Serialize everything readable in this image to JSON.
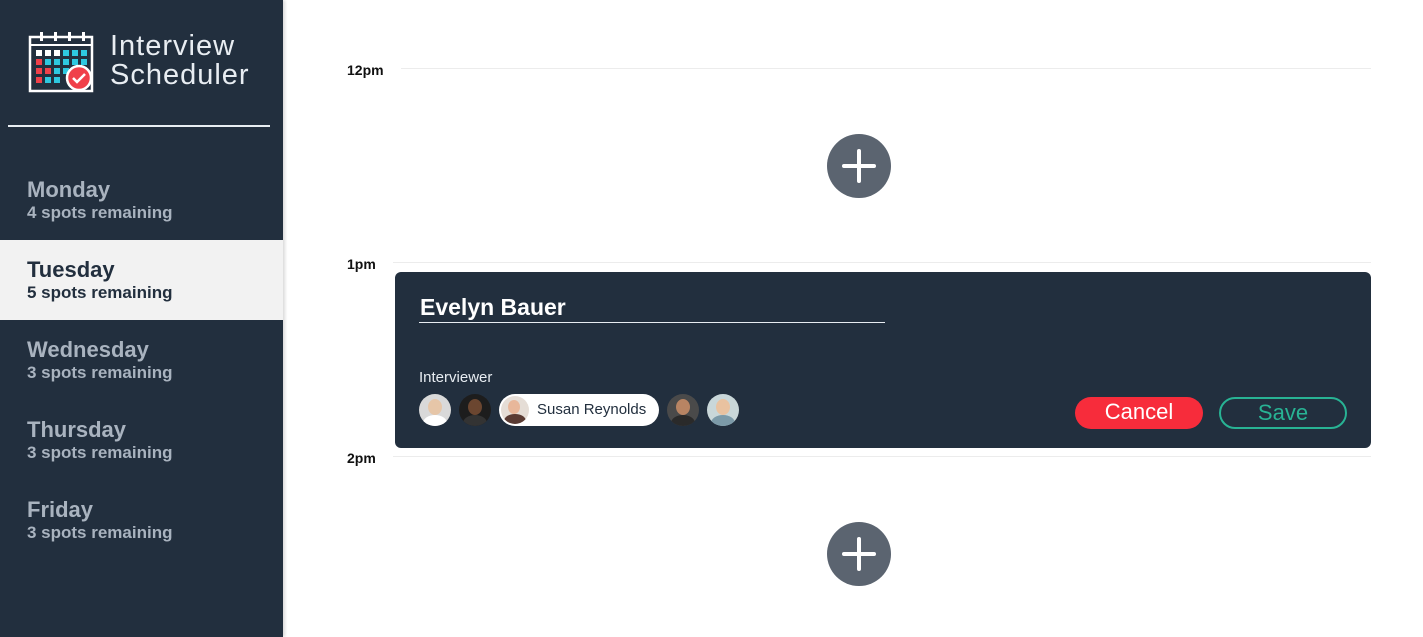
{
  "app": {
    "title_line1": "Interview",
    "title_line2": "Scheduler",
    "logo_icon": "calendar-check-icon"
  },
  "days": [
    {
      "name": "Monday",
      "spots": "4 spots remaining",
      "selected": false
    },
    {
      "name": "Tuesday",
      "spots": "5 spots remaining",
      "selected": true
    },
    {
      "name": "Wednesday",
      "spots": "3 spots remaining",
      "selected": false
    },
    {
      "name": "Thursday",
      "spots": "3 spots remaining",
      "selected": false
    },
    {
      "name": "Friday",
      "spots": "3 spots remaining",
      "selected": false
    }
  ],
  "schedule": {
    "slots": [
      "12pm",
      "1pm",
      "2pm"
    ],
    "add_icon": "plus-icon"
  },
  "form": {
    "student_name": "Evelyn Bauer",
    "interviewer_label": "Interviewer",
    "selected_interviewer": "Susan Reynolds",
    "cancel_label": "Cancel",
    "save_label": "Save"
  },
  "colors": {
    "sidebar": "#222f3e",
    "selected_day": "#f2f2f2",
    "cancel": "#f72c3b",
    "save": "#28b394",
    "add_button": "#5b6470"
  }
}
